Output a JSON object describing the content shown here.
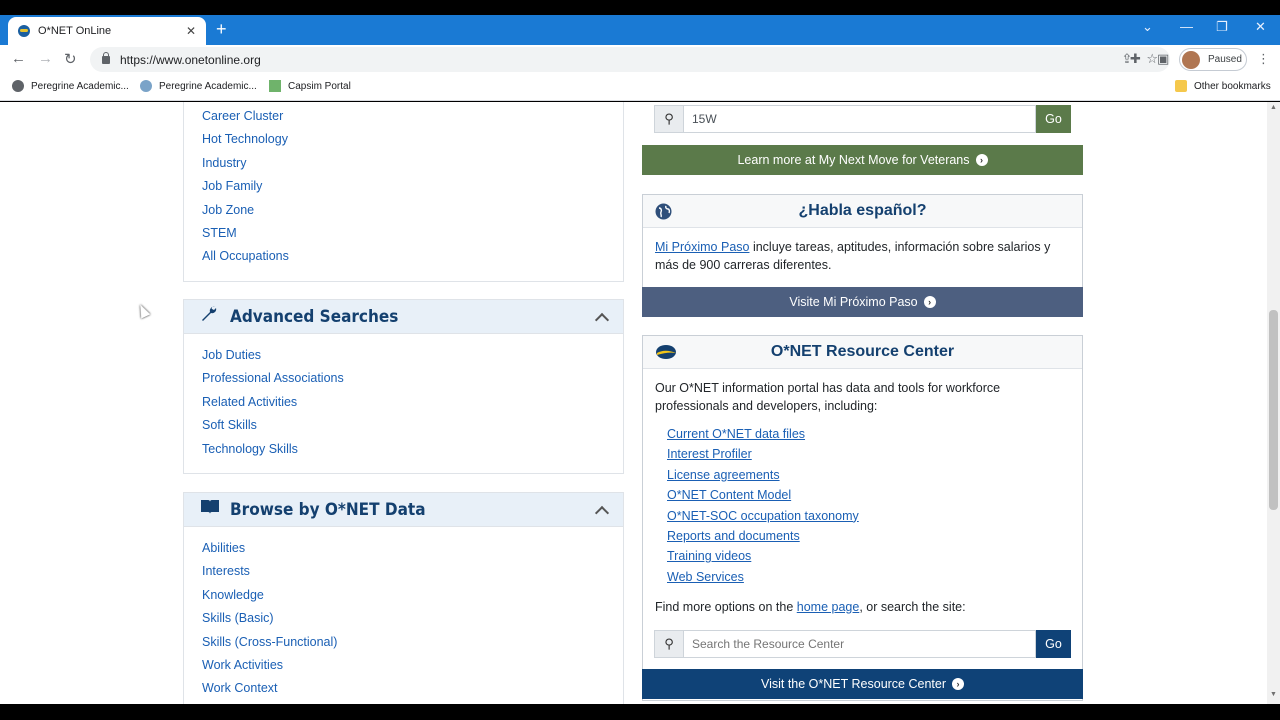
{
  "browser": {
    "tab_title": "O*NET OnLine",
    "url": "https://www.onetonline.org",
    "profile_status": "Paused",
    "bookmarks": [
      "Peregrine Academic...",
      "Peregrine Academic...",
      "Capsim Portal"
    ],
    "other_bookmarks": "Other bookmarks"
  },
  "left": {
    "top_links": [
      "Career Cluster",
      "Hot Technology",
      "Industry",
      "Job Family",
      "Job Zone",
      "STEM",
      "All Occupations"
    ],
    "advanced": {
      "title": "Advanced Searches",
      "links": [
        "Job Duties",
        "Professional Associations",
        "Related Activities",
        "Soft Skills",
        "Technology Skills"
      ]
    },
    "browse": {
      "title": "Browse by O*NET Data",
      "links": [
        "Abilities",
        "Interests",
        "Knowledge",
        "Skills (Basic)",
        "Skills (Cross-Functional)",
        "Work Activities",
        "Work Context"
      ]
    }
  },
  "right": {
    "veterans": {
      "search_value": "15W",
      "go": "Go",
      "button": "Learn more at My Next Move for Veterans"
    },
    "espanol": {
      "title": "¿Habla español?",
      "link": "Mi Próximo Paso",
      "text": " incluye tareas, aptitudes, información sobre salarios y más de 900 carreras diferentes.",
      "button": "Visite Mi Próximo Paso"
    },
    "resource": {
      "title": "O*NET Resource Center",
      "intro": "Our O*NET information portal has data and tools for workforce professionals and developers, including:",
      "links": [
        "Current O*NET data files",
        "Interest Profiler",
        "License agreements",
        "O*NET Content Model",
        "O*NET-SOC occupation taxonomy",
        "Reports and documents",
        "Training videos",
        "Web Services"
      ],
      "find_prefix": "Find more options on the ",
      "find_link": "home page",
      "find_suffix": ", or search the site:",
      "search_placeholder": "Search the Resource Center",
      "go": "Go",
      "button": "Visit the O*NET Resource Center"
    }
  },
  "colors": {
    "link": "#1a5fb4",
    "heading": "#14406f",
    "veterans_green": "#5b7a4a",
    "espanol_slate": "#4d5f80",
    "resource_navy": "#0f4277"
  }
}
